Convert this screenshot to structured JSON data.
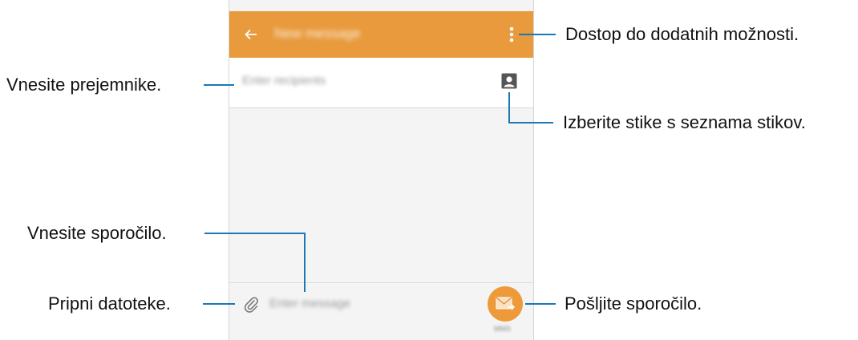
{
  "app_bar": {
    "title": "New message",
    "back_icon": "arrow-left-icon",
    "more_icon": "more-vertical-icon",
    "color": "#e89a3c"
  },
  "recipient": {
    "placeholder": "Enter recipients",
    "contact_icon": "contact-icon"
  },
  "compose": {
    "placeholder": "Enter message",
    "attach_icon": "paperclip-icon",
    "send_icon": "send-mail-icon",
    "send_caption": "MMS",
    "send_color": "#ee9a3a"
  },
  "callouts": {
    "more_options": "Dostop do dodatnih možnosti.",
    "enter_recipients": "Vnesite prejemnike.",
    "select_contacts": "Izberite stike s seznama stikov.",
    "enter_message": "Vnesite sporočilo.",
    "attach_files": "Pripni datoteke.",
    "send_message": "Pošljite sporočilo."
  },
  "line_color": "#1a78b6"
}
